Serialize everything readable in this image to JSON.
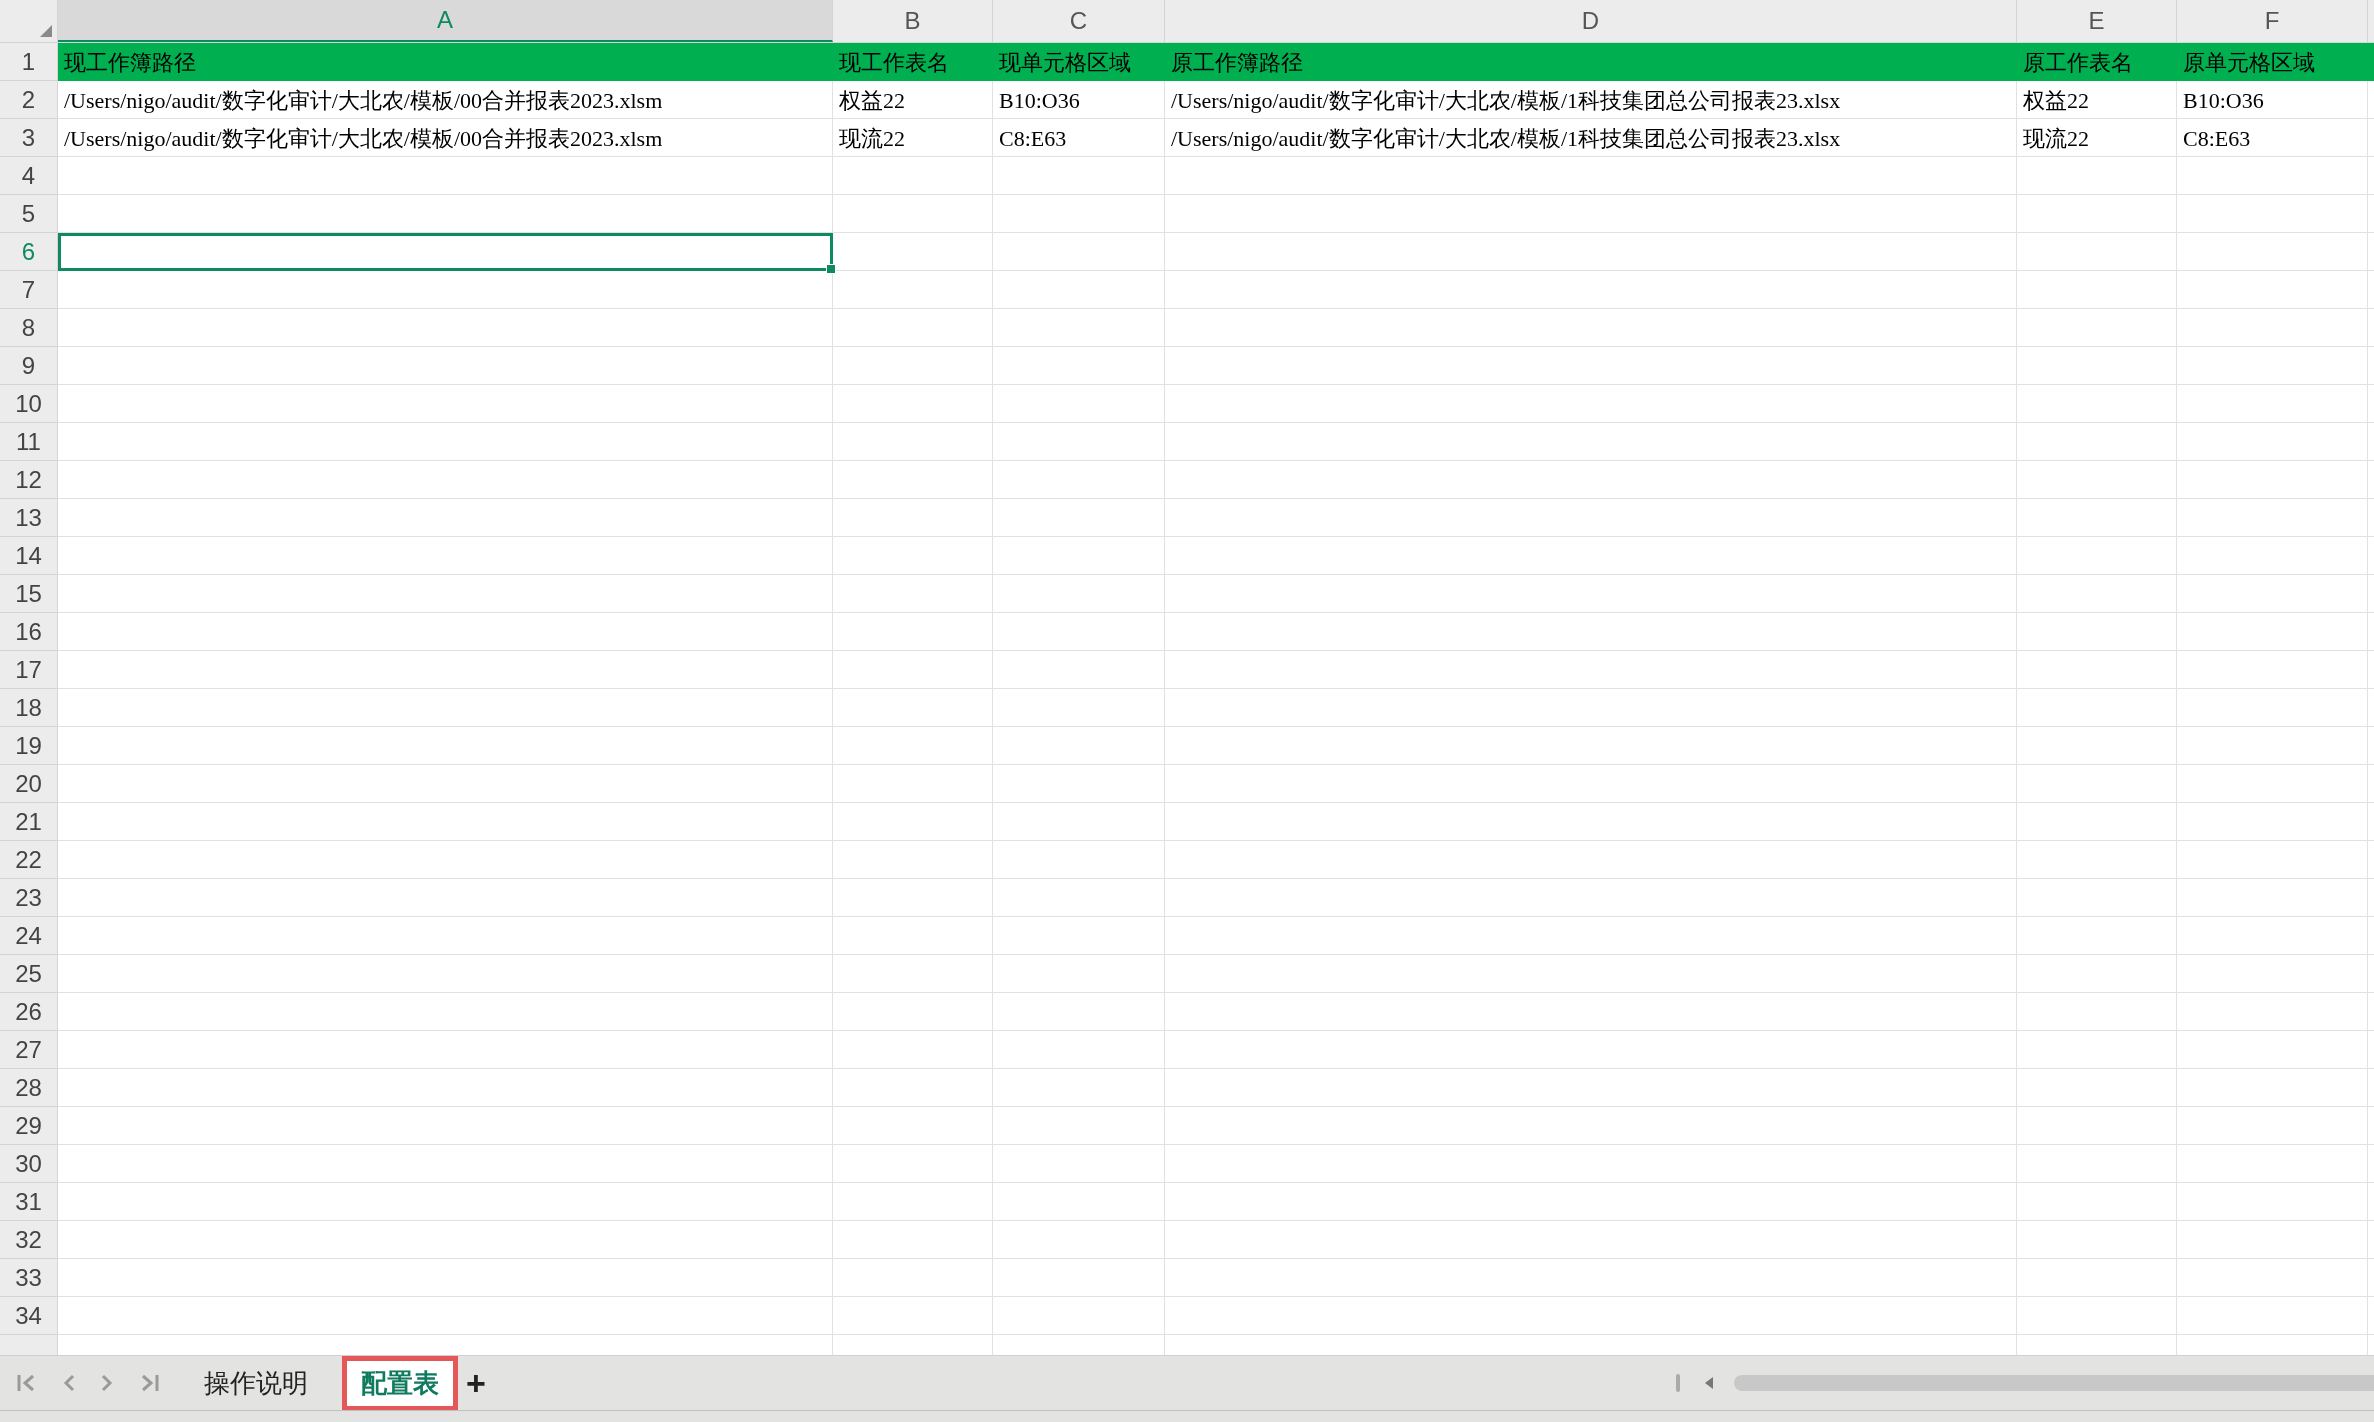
{
  "columns": [
    {
      "letter": "A",
      "selected": true
    },
    {
      "letter": "B",
      "selected": false
    },
    {
      "letter": "C",
      "selected": false
    },
    {
      "letter": "D",
      "selected": false
    },
    {
      "letter": "E",
      "selected": false
    },
    {
      "letter": "F",
      "selected": false
    }
  ],
  "rows": [
    {
      "number": "1",
      "selected": false,
      "kind": "header",
      "cells": [
        "现工作簿路径",
        "现工作表名",
        "现单元格区域",
        "原工作簿路径",
        "原工作表名",
        "原单元格区域"
      ]
    },
    {
      "number": "2",
      "selected": false,
      "kind": "data",
      "cells": [
        "/Users/nigo/audit/数字化审计/大北农/模板/00合并报表2023.xlsm",
        "权益22",
        "B10:O36",
        "/Users/nigo/audit/数字化审计/大北农/模板/1科技集团总公司报表23.xlsx",
        "权益22",
        "B10:O36"
      ]
    },
    {
      "number": "3",
      "selected": false,
      "kind": "data",
      "cells": [
        "/Users/nigo/audit/数字化审计/大北农/模板/00合并报表2023.xlsm",
        "现流22",
        "C8:E63",
        "/Users/nigo/audit/数字化审计/大北农/模板/1科技集团总公司报表23.xlsx",
        "现流22",
        "C8:E63"
      ]
    },
    {
      "number": "4",
      "selected": false,
      "kind": "data"
    },
    {
      "number": "5",
      "selected": false,
      "kind": "data"
    },
    {
      "number": "6",
      "selected": true,
      "kind": "data"
    },
    {
      "number": "7",
      "selected": false,
      "kind": "data"
    },
    {
      "number": "8",
      "selected": false,
      "kind": "data"
    },
    {
      "number": "9",
      "selected": false,
      "kind": "data"
    },
    {
      "number": "10",
      "selected": false,
      "kind": "data"
    },
    {
      "number": "11",
      "selected": false,
      "kind": "data"
    },
    {
      "number": "12",
      "selected": false,
      "kind": "data"
    },
    {
      "number": "13",
      "selected": false,
      "kind": "data"
    },
    {
      "number": "14",
      "selected": false,
      "kind": "data"
    },
    {
      "number": "15",
      "selected": false,
      "kind": "data"
    },
    {
      "number": "16",
      "selected": false,
      "kind": "data"
    },
    {
      "number": "17",
      "selected": false,
      "kind": "data"
    },
    {
      "number": "18",
      "selected": false,
      "kind": "data"
    },
    {
      "number": "19",
      "selected": false,
      "kind": "data"
    },
    {
      "number": "20",
      "selected": false,
      "kind": "data"
    },
    {
      "number": "21",
      "selected": false,
      "kind": "data"
    },
    {
      "number": "22",
      "selected": false,
      "kind": "data"
    },
    {
      "number": "23",
      "selected": false,
      "kind": "data"
    },
    {
      "number": "24",
      "selected": false,
      "kind": "data"
    },
    {
      "number": "25",
      "selected": false,
      "kind": "data"
    },
    {
      "number": "26",
      "selected": false,
      "kind": "data"
    },
    {
      "number": "27",
      "selected": false,
      "kind": "data"
    },
    {
      "number": "28",
      "selected": false,
      "kind": "data"
    },
    {
      "number": "29",
      "selected": false,
      "kind": "data"
    },
    {
      "number": "30",
      "selected": false,
      "kind": "data"
    },
    {
      "number": "31",
      "selected": false,
      "kind": "data"
    },
    {
      "number": "32",
      "selected": false,
      "kind": "data"
    },
    {
      "number": "33",
      "selected": false,
      "kind": "data"
    },
    {
      "number": "34",
      "selected": false,
      "kind": "data"
    }
  ],
  "sheet_tabs": [
    {
      "label": "操作说明",
      "selected": false
    },
    {
      "label": "配置表",
      "selected": true
    }
  ],
  "add_sheet": "+"
}
